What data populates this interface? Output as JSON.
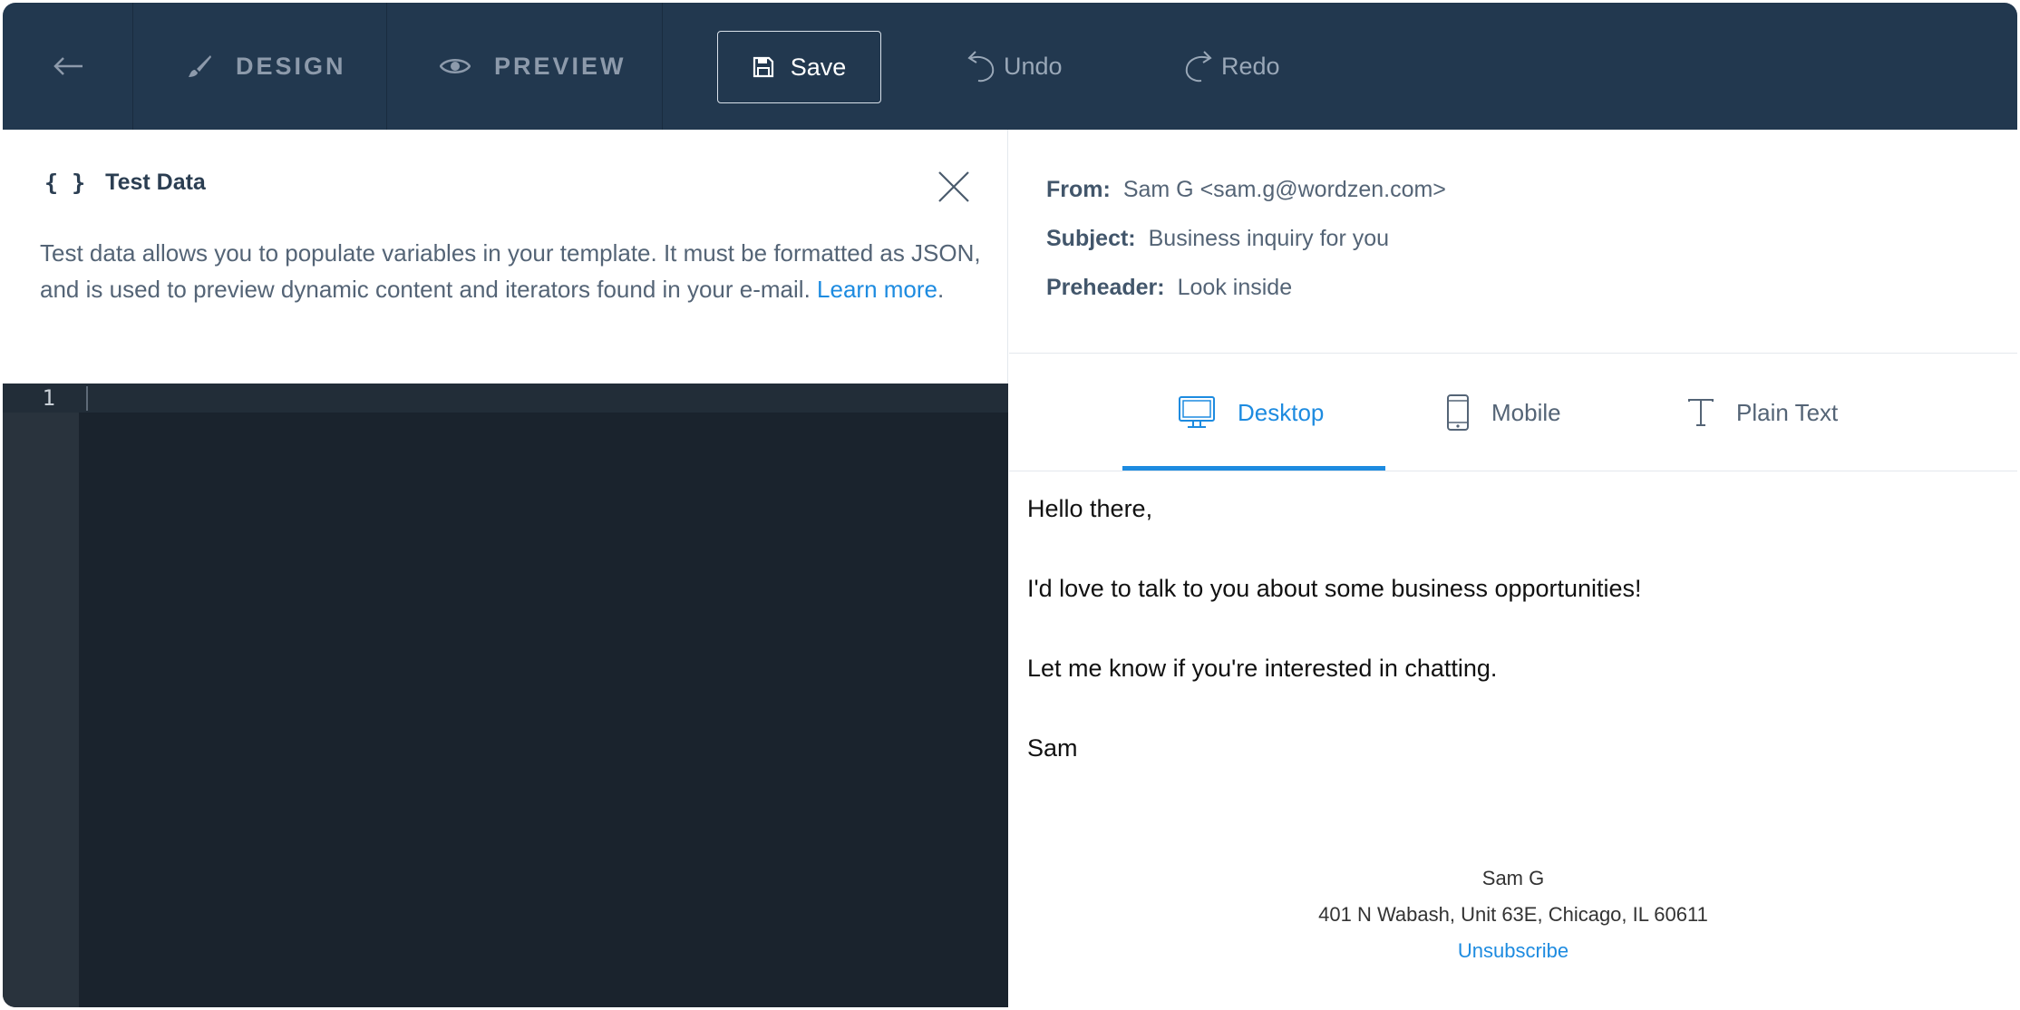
{
  "toolbar": {
    "design_label": "DESIGN",
    "preview_label": "PREVIEW",
    "save_label": "Save",
    "undo_label": "Undo",
    "redo_label": "Redo"
  },
  "test_data": {
    "title": "Test Data",
    "braces": "{ }",
    "description": "Test data allows you to populate variables in your template. It must be formatted as JSON, and is used to preview dynamic content and iterators found in your e-mail.",
    "learn_more": "Learn more",
    "period": ".",
    "line_number": "1"
  },
  "meta": {
    "from_label": "From:",
    "from_value": "Sam G <sam.g@wordzen.com>",
    "subject_label": "Subject:",
    "subject_value": "Business inquiry for you",
    "preheader_label": "Preheader:",
    "preheader_value": "Look inside"
  },
  "tabs": [
    {
      "label": "Desktop",
      "icon": "desktop-icon",
      "active": true
    },
    {
      "label": "Mobile",
      "icon": "mobile-icon",
      "active": false
    },
    {
      "label": "Plain Text",
      "icon": "text-icon",
      "active": false
    }
  ],
  "email": {
    "lines": [
      "Hello there,",
      "I'd love to talk to you about some business opportunities!",
      "Let me know if you're interested in chatting.",
      "Sam"
    ],
    "footer_name": "Sam G",
    "footer_address": "401 N Wabash, Unit 63E, Chicago, IL 60611",
    "unsubscribe": "Unsubscribe"
  },
  "colors": {
    "toolbar_bg": "#22384f",
    "accent": "#1d8be0",
    "editor_bg": "#1a232d"
  }
}
